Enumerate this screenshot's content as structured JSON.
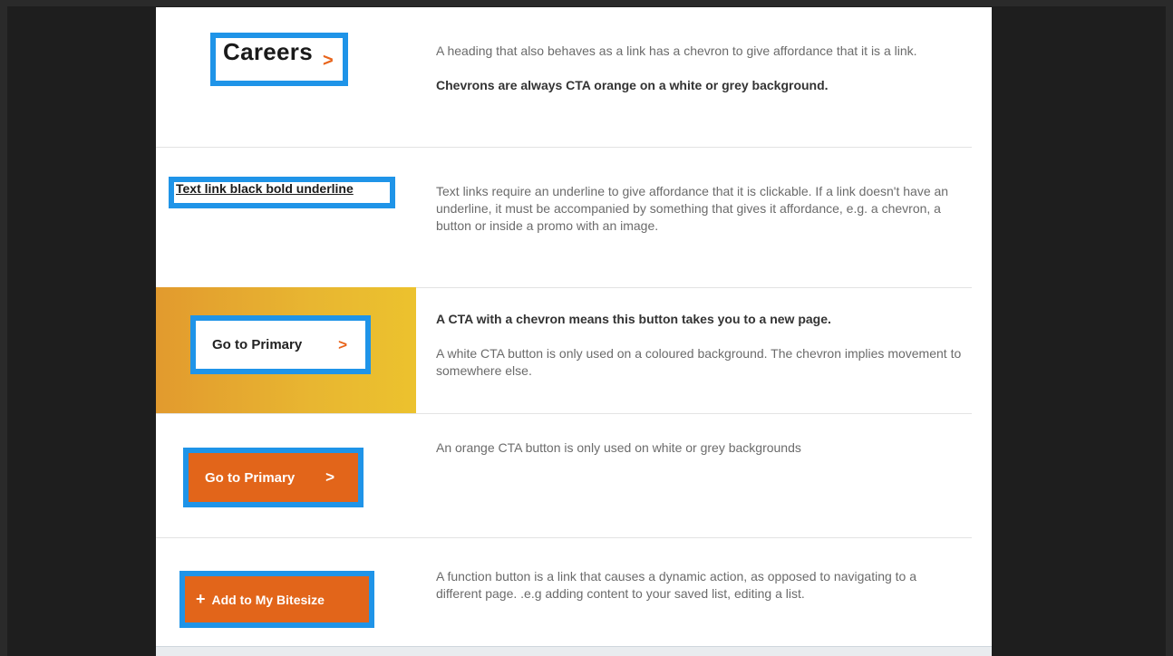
{
  "rows": {
    "careers": {
      "heading": "Careers",
      "chevron": ">",
      "description": "A heading that also behaves as a link has a chevron to give affordance that it is a link.",
      "note": "Chevrons are always CTA orange on a white or grey background."
    },
    "text_link": {
      "link_text": "Text link black bold underline",
      "description": "Text links require an underline to give affordance that it is clickable. If a link doesn't have an underline, it must be accompanied by something that gives it affordance, e.g. a chevron, a button or inside a promo with an image."
    },
    "white_cta": {
      "button_label": "Go to Primary",
      "chevron": ">",
      "heading": "A CTA with a chevron means this button takes you to a new page.",
      "description": "A white CTA button is only used on a coloured background. The chevron implies movement to somewhere else."
    },
    "orange_cta": {
      "button_label": "Go to Primary",
      "chevron": ">",
      "description": "An orange CTA button is only used on white or grey backgrounds"
    },
    "function_button": {
      "icon": "plus-icon",
      "plus": "+",
      "button_label": "Add to My Bitesize",
      "description": "A function button is a link that causes a dynamic action, as opposed to navigating to a different page. .e.g adding content to your saved list, editing a list."
    }
  },
  "colors": {
    "cta_orange": "#e2651a",
    "highlight_blue": "#1f94e8",
    "gradient_start": "#e29a2e",
    "gradient_end": "#ecc22e"
  }
}
